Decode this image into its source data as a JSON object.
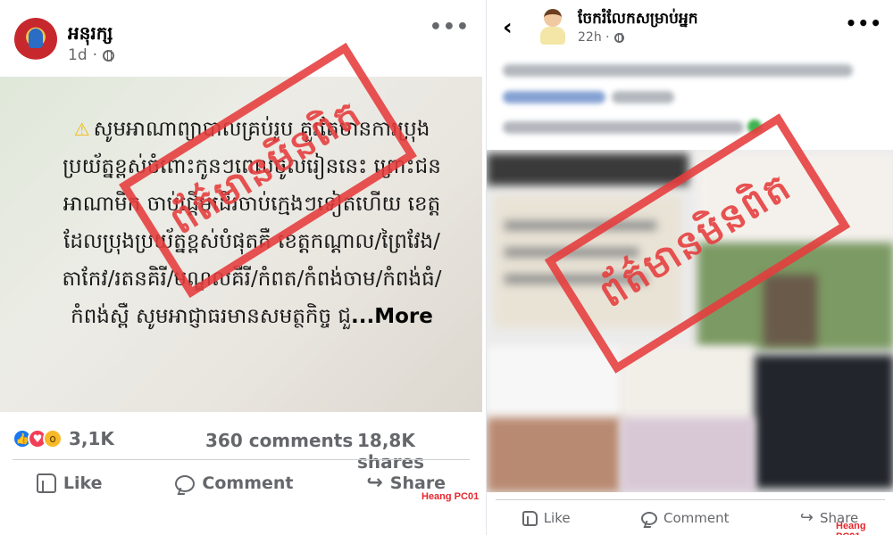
{
  "left_post": {
    "page_name": "អនុរក្ស",
    "time": "1d",
    "warning_icon": "warning-icon",
    "body_text": "សូមអាណាព្យាបាលគ្រប់រូប គួរតែមានការប្រុងប្រយ័ត្នខ្ពស់ចំពោះកូនៗពេលចូលរៀននេះ ព្រោះជនអាណាមិក ចាប់ផ្តើមដើរចាប់ក្មេងៗទៀតហើយ ខេត្តដែលប្រុងប្រយ័ត្នខ្ពស់បំផុតគឺ ខេត្តកណ្តាល/ព្រៃវែង/តាកែវ/រតនគិរី/មណ្ឌលគីរី/កំពត/កំពង់ចាម/កំពង់ធំ/កំពង់ស្ពឺ សូមអាជ្ញាធរមានសមត្ថកិច្ច ជួ",
    "more_label": "...More",
    "reactions_count": "3,1K",
    "comments": "360 comments",
    "shares": "18,8K shares",
    "actions": {
      "like": "Like",
      "comment": "Comment",
      "share": "Share"
    },
    "stamp_text": "ព័ត៌មានមិនពិត",
    "credit": "Heang PC01"
  },
  "right_post": {
    "page_name": "ចែករំលែកសម្រាប់អ្នក",
    "time": "22h ·",
    "actions": {
      "like": "Like",
      "comment": "Comment",
      "share": "Share"
    },
    "stamp_text": "ព័ត៌មានមិនពិត",
    "credit": "Heang PC01"
  },
  "colors": {
    "stamp": "#e63c3c",
    "credit": "#e6262d",
    "link": "#1877f2",
    "muted": "#65676b"
  }
}
